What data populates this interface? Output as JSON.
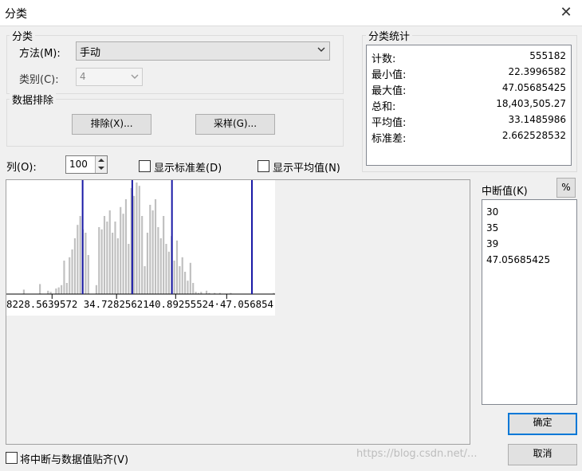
{
  "window": {
    "title": "分类"
  },
  "classification": {
    "group_title": "分类",
    "method_label": "方法(M):",
    "method_value": "手动",
    "classes_label": "类别(C):",
    "classes_value": "4"
  },
  "exclusion": {
    "group_title": "数据排除",
    "exclude_button": "排除(X)...",
    "sampling_button": "采样(G)..."
  },
  "stats": {
    "group_title": "分类统计",
    "rows": [
      {
        "label": "计数:",
        "value": "555182"
      },
      {
        "label": "最小值:",
        "value": "22.3996582"
      },
      {
        "label": "最大值:",
        "value": "47.05685425"
      },
      {
        "label": "总和:",
        "value": "18,403,505.27"
      },
      {
        "label": "平均值:",
        "value": "33.1485986"
      },
      {
        "label": "标准差:",
        "value": "2.662528532"
      }
    ]
  },
  "histogram": {
    "columns_label": "列(O):",
    "columns_value": "100",
    "show_std_label": "显示标准差(D)",
    "show_mean_label": "显示平均值(N)",
    "axis_text": "8228.5639572 34.7282562140.89255524·47.056854",
    "x_min": 22.3996582,
    "x_max": 47.05685425,
    "breaks": [
      30,
      35,
      39,
      47.05685425
    ],
    "bar_heights": [
      0,
      0,
      0,
      0,
      0,
      0,
      0.04,
      0,
      0,
      0,
      0,
      0,
      0.09,
      0,
      0,
      0.03,
      0.02,
      0,
      0.05,
      0.06,
      0.08,
      0.3,
      0.1,
      0.33,
      0.4,
      0.5,
      0.62,
      0.7,
      0.58,
      0.55,
      0.35,
      0,
      0,
      0.08,
      0.6,
      0.58,
      0.7,
      0.65,
      0.75,
      0.55,
      0.65,
      0.5,
      0.78,
      0.72,
      0.85,
      0.45,
      0.95,
      0.88,
      1,
      0.97,
      0.7,
      0.25,
      0.55,
      0.8,
      0.75,
      0.85,
      0.6,
      0.5,
      0.7,
      0.45,
      0.38,
      0.52,
      0.3,
      0.48,
      0.25,
      0.33,
      0.2,
      0.12,
      0.28,
      0.1,
      0.02,
      0.01,
      0.02,
      0,
      0.03,
      0.01,
      0,
      0.01,
      0,
      0.01,
      0,
      0,
      0,
      0.01,
      0,
      0,
      0,
      0,
      0,
      0,
      0,
      0,
      0,
      0,
      0,
      0,
      0,
      0,
      0,
      0.01
    ]
  },
  "breaks_panel": {
    "label": "中断值(K)",
    "percent_button": "%",
    "values": [
      "30",
      "35",
      "39",
      "47.05685425"
    ]
  },
  "footer": {
    "snap_label": "将中断与数据值贴齐(V)",
    "ok_button": "确定",
    "cancel_button": "取消",
    "watermark": "https://blog.csdn.net/..."
  }
}
